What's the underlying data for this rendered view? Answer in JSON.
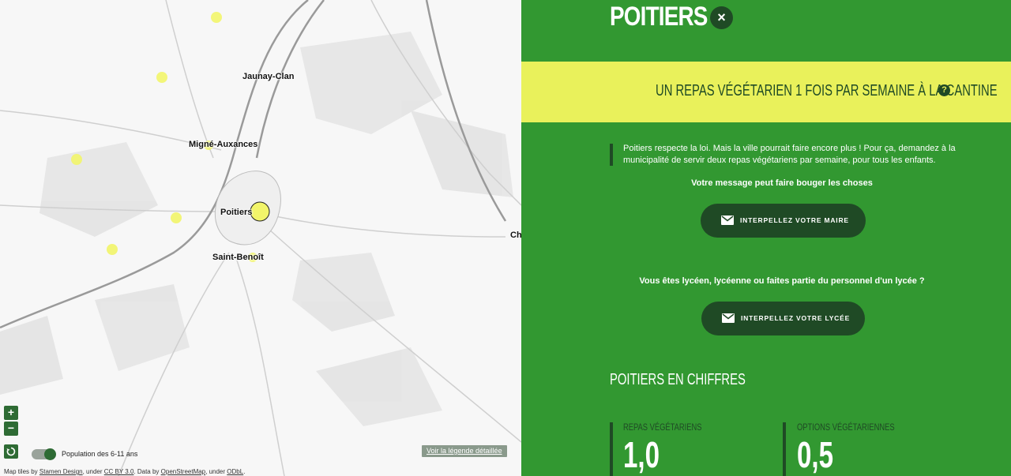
{
  "map": {
    "places": [
      "Jaunay-Clan",
      "Migné-Auxances",
      "Poitiers",
      "Saint-Benoît",
      "Ch"
    ],
    "zoom_in": "+",
    "zoom_out": "−",
    "toggle_label": "Population des 6-11 ans",
    "legend_link": "Voir la légende détaillée",
    "attribution": {
      "prefix": "Map tiles by ",
      "stamen": "Stamen Design",
      "under1": ", under ",
      "ccby": "CC BY 3.0",
      "data": ". Data by ",
      "osm": "OpenStreetMap",
      "under2": ", under ",
      "odbl": "ODbL",
      "end": "."
    },
    "colors": {
      "marker": "#f2f56a",
      "button": "#2e6b34"
    }
  },
  "panel": {
    "city": "POITIERS",
    "close_icon": "×",
    "banner_text": "UN REPAS VÉGÉTARIEN 1 FOIS PAR SEMAINE À LA CANTINE",
    "help_icon": "?",
    "quote": "Poitiers respecte la loi. Mais la ville pourrait faire encore plus ! Pour ça, demandez à la municipalité de servir deux repas végétariens par semaine, pour tous les enfants.",
    "message_title": "Votre message peut faire bouger les choses",
    "cta_mayor": "INTERPELLEZ VOTRE MAIRE",
    "question": "Vous êtes lycéen, lycéenne ou faites partie du personnel d'un lycée ?",
    "cta_school": "INTERPELLEZ VOTRE LYCÉE",
    "figures_title": "POITIERS EN CHIFFRES",
    "stats": [
      {
        "label": "REPAS VÉGÉTARIENS",
        "value": "1,0"
      },
      {
        "label": "OPTIONS VÉGÉTARIENNES",
        "value": "0,5"
      }
    ],
    "colors": {
      "background": "#329831",
      "banner": "#e9f15b",
      "dark": "#1f4a25"
    }
  }
}
